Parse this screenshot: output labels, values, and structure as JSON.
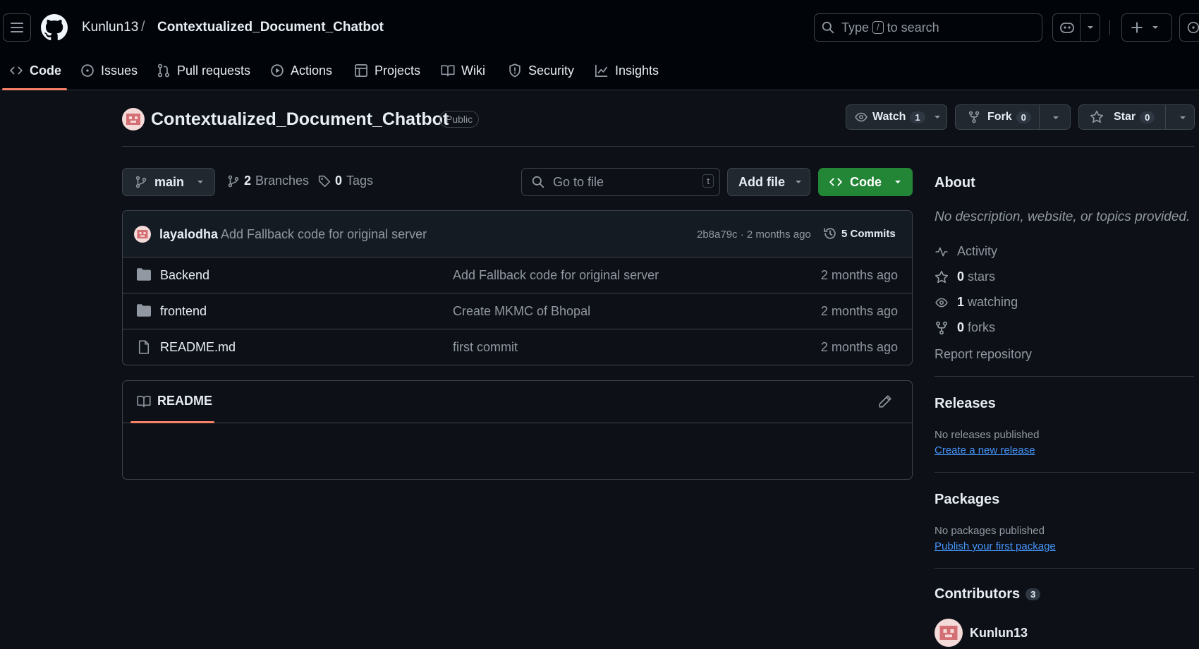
{
  "header": {
    "owner": "Kunlun13",
    "separator": "/",
    "repo": "Contextualized_Document_Chatbot",
    "search_prefix": "Type",
    "search_key": "/",
    "search_suffix": "to search"
  },
  "nav": {
    "tabs": [
      {
        "label": "Code",
        "icon": "code-icon"
      },
      {
        "label": "Issues",
        "icon": "issue-icon"
      },
      {
        "label": "Pull requests",
        "icon": "pull-request-icon"
      },
      {
        "label": "Actions",
        "icon": "play-icon"
      },
      {
        "label": "Projects",
        "icon": "table-icon"
      },
      {
        "label": "Wiki",
        "icon": "book-icon"
      },
      {
        "label": "Security",
        "icon": "shield-icon"
      },
      {
        "label": "Insights",
        "icon": "graph-icon"
      }
    ],
    "active": "Code"
  },
  "repo": {
    "title": "Contextualized_Document_Chatbot",
    "visibility": "Public",
    "watch_label": "Watch",
    "watch_count": "1",
    "fork_label": "Fork",
    "fork_count": "0",
    "star_label": "Star",
    "star_count": "0"
  },
  "toolbar": {
    "branch": "main",
    "branches_count": "2",
    "branches_label": "Branches",
    "tags_count": "0",
    "tags_label": "Tags",
    "go_to_file_placeholder": "Go to file",
    "go_to_file_key": "t",
    "add_file_label": "Add file",
    "code_label": "Code"
  },
  "latest_commit": {
    "author": "layalodha",
    "message": "Add Fallback code for original server",
    "hash_time": "2b8a79c · 2 months ago",
    "commits_label": "5 Commits"
  },
  "files": [
    {
      "name": "Backend",
      "type": "folder",
      "message": "Add Fallback code for original server",
      "date": "2 months ago"
    },
    {
      "name": "frontend",
      "type": "folder",
      "message": "Create MKMC of Bhopal",
      "date": "2 months ago"
    },
    {
      "name": "README.md",
      "type": "file",
      "message": "first commit",
      "date": "2 months ago"
    }
  ],
  "readme": {
    "title": "README"
  },
  "sidebar": {
    "about_title": "About",
    "about_desc": "No description, website, or topics provided.",
    "activity": "Activity",
    "stars_count": "0",
    "stars_label": "stars",
    "watching_count": "1",
    "watching_label": "watching",
    "forks_count": "0",
    "forks_label": "forks",
    "report": "Report repository",
    "releases_title": "Releases",
    "releases_none": "No releases published",
    "releases_link": "Create a new release",
    "packages_title": "Packages",
    "packages_none": "No packages published",
    "packages_link": "Publish your first package",
    "contributors_title": "Contributors",
    "contributors_count": "3",
    "contributor_name": "Kunlun13"
  },
  "colors": {
    "background": "#0d1117",
    "header": "#010409",
    "accent_tab": "#f78166",
    "code_button": "#238636",
    "link": "#4493f8"
  }
}
